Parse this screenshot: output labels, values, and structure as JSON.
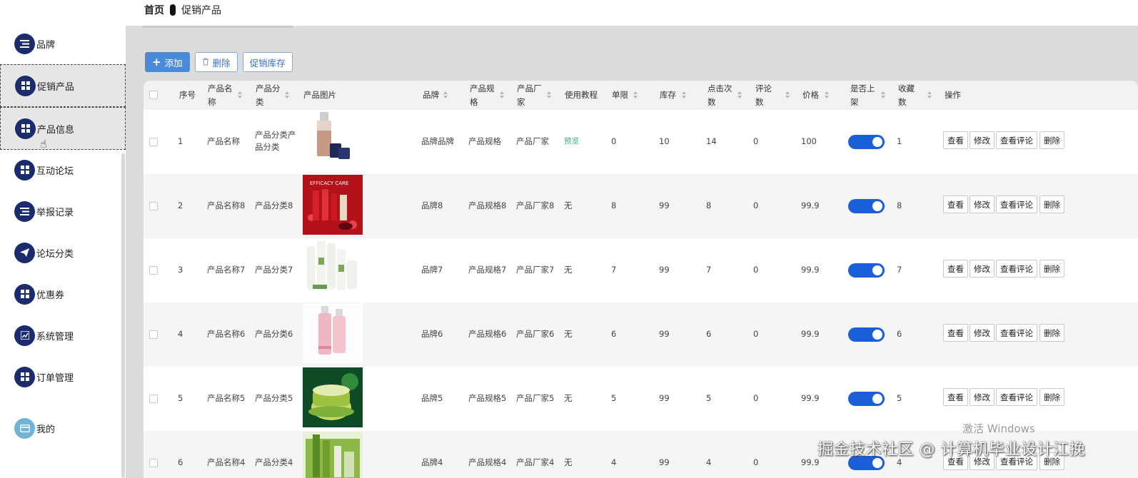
{
  "breadcrumb": {
    "home": "首页",
    "current": "促销产品"
  },
  "sidebar": {
    "items": [
      {
        "label": "品牌",
        "icon": "list-icon"
      },
      {
        "label": "促销产品",
        "icon": "grid-icon"
      },
      {
        "label": "产品信息",
        "icon": "grid-icon"
      },
      {
        "label": "互动论坛",
        "icon": "grid-icon"
      },
      {
        "label": "举报记录",
        "icon": "list-icon"
      },
      {
        "label": "论坛分类",
        "icon": "send-icon"
      },
      {
        "label": "优惠券",
        "icon": "grid-icon"
      },
      {
        "label": "系统管理",
        "icon": "chart-icon"
      },
      {
        "label": "订单管理",
        "icon": "grid-icon"
      },
      {
        "label": "我的",
        "icon": "card-icon"
      }
    ]
  },
  "toolbar": {
    "add_label": "添加",
    "delete_label": "删除",
    "stock_label": "促销库存"
  },
  "table": {
    "headers": {
      "index": "序号",
      "name": [
        "产品名",
        "称"
      ],
      "category": [
        "产品分",
        "类"
      ],
      "image": "产品图片",
      "brand": "品牌",
      "spec": [
        "产品规",
        "格"
      ],
      "maker": [
        "产品厂",
        "家"
      ],
      "tutorial": "使用教程",
      "limit": "单限",
      "stock": "库存",
      "clicks": [
        "点击次",
        "数"
      ],
      "comments": [
        "评论",
        "数"
      ],
      "price": "价格",
      "listed": [
        "是否上",
        "架"
      ],
      "favorites": [
        "收藏",
        "数"
      ],
      "actions": "操作"
    },
    "action_labels": {
      "view": "查看",
      "edit": "修改",
      "view_comments": "查看评论",
      "delete": "删除"
    },
    "rows": [
      {
        "index": "1",
        "name": "产品名称",
        "category": [
          "产品分类产",
          "品分类"
        ],
        "brand": "品牌品牌",
        "spec": "产品规格",
        "maker": "产品厂家",
        "tutorial": "预览",
        "limit": "0",
        "stock": "10",
        "clicks": "14",
        "comments": "0",
        "price": "100",
        "favorites": "1"
      },
      {
        "index": "2",
        "name": "产品名称8",
        "category": [
          "产品分类8"
        ],
        "brand": "品牌8",
        "spec": "产品规格8",
        "maker": "产品厂家8",
        "tutorial": "无",
        "limit": "8",
        "stock": "99",
        "clicks": "8",
        "comments": "0",
        "price": "99.9",
        "favorites": "8"
      },
      {
        "index": "3",
        "name": "产品名称7",
        "category": [
          "产品分类7"
        ],
        "brand": "品牌7",
        "spec": "产品规格7",
        "maker": "产品厂家7",
        "tutorial": "无",
        "limit": "7",
        "stock": "99",
        "clicks": "7",
        "comments": "0",
        "price": "99.9",
        "favorites": "7"
      },
      {
        "index": "4",
        "name": "产品名称6",
        "category": [
          "产品分类6"
        ],
        "brand": "品牌6",
        "spec": "产品规格6",
        "maker": "产品厂家6",
        "tutorial": "无",
        "limit": "6",
        "stock": "99",
        "clicks": "6",
        "comments": "0",
        "price": "99.9",
        "favorites": "6"
      },
      {
        "index": "5",
        "name": "产品名称5",
        "category": [
          "产品分类5"
        ],
        "brand": "品牌5",
        "spec": "产品规格5",
        "maker": "产品厂家5",
        "tutorial": "无",
        "limit": "5",
        "stock": "99",
        "clicks": "5",
        "comments": "0",
        "price": "99.9",
        "favorites": "5"
      },
      {
        "index": "6",
        "name": "产品名称4",
        "category": [
          "产品分类4"
        ],
        "brand": "品牌4",
        "spec": "产品规格4",
        "maker": "产品厂家4",
        "tutorial": "无",
        "limit": "4",
        "stock": "99",
        "clicks": "4",
        "comments": "0",
        "price": "99.9",
        "favorites": "4"
      }
    ]
  },
  "overlay": {
    "activate": "激活 Windows",
    "watermark": "掘金技术社区 @ 计算机毕业设计江挽"
  },
  "colors": {
    "sidebar_icon": "#1b2c6e",
    "primary": "#4a8bd8",
    "switch_on": "#1a5fd8",
    "preview_link": "#2eb872"
  }
}
